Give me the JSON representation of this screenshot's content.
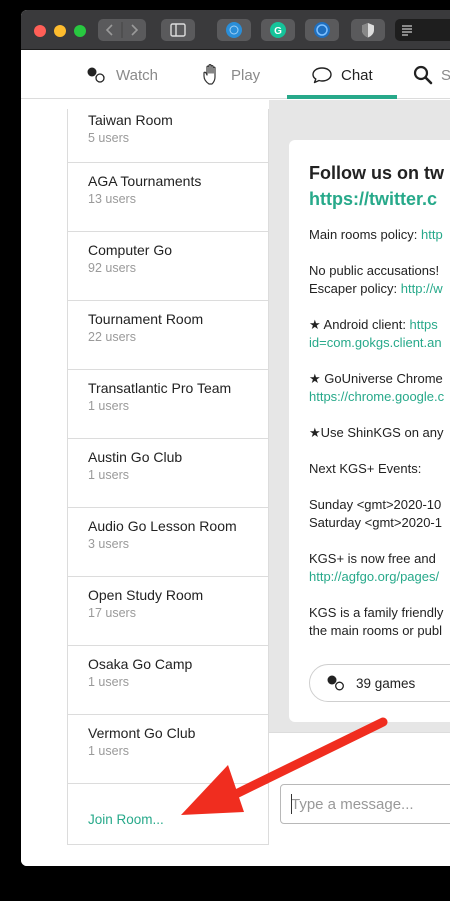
{
  "nav": {
    "tabs": [
      {
        "label": "Watch",
        "icon": "stones-icon"
      },
      {
        "label": "Play",
        "icon": "hand-icon"
      },
      {
        "label": "Chat",
        "icon": "chat-bubble-icon"
      },
      {
        "label": "S",
        "icon": "search-icon"
      }
    ],
    "active_tab": "Chat",
    "accent": "#27a98a"
  },
  "rooms": [
    {
      "name": "Taiwan Room",
      "users": "5 users"
    },
    {
      "name": "AGA Tournaments",
      "users": "13 users"
    },
    {
      "name": "Computer Go",
      "users": "92 users"
    },
    {
      "name": "Tournament Room",
      "users": "22 users"
    },
    {
      "name": "Transatlantic Pro Team",
      "users": "1 users"
    },
    {
      "name": "Austin Go Club",
      "users": "1 users"
    },
    {
      "name": "Audio Go Lesson Room",
      "users": "3 users"
    },
    {
      "name": "Open Study Room",
      "users": "17 users"
    },
    {
      "name": "Osaka Go Camp",
      "users": "1 users"
    },
    {
      "name": "Vermont Go Club",
      "users": "1 users"
    }
  ],
  "join_room_label": "Join Room...",
  "card": {
    "heading": "Follow us on tw",
    "heading_link": "https://twitter.c",
    "policy_label": "Main rooms policy: ",
    "policy_link": "http",
    "accusations": "No public accusations!",
    "escaper_label": "Escaper policy: ",
    "escaper_link": "http://w",
    "android_label": "★ Android client: ",
    "android_link": "https",
    "android_link2": "id=com.gokgs.client.an",
    "gouniverse_label": "★ GoUniverse Chrome",
    "gouniverse_link": "https://chrome.google.c",
    "shinkgs": "★Use ShinKGS on any",
    "events_heading": "Next KGS+ Events:",
    "event1": "Sunday <gmt>2020-10",
    "event2": "Saturday <gmt>2020-1",
    "kgsplus": "KGS+ is now free and",
    "kgsplus_link": "http://agfgo.org/pages/",
    "family1": "KGS is a family friendly",
    "family2": "the main rooms or publ",
    "games_count": "39 games"
  },
  "message": {
    "placeholder": "Type a message..."
  }
}
